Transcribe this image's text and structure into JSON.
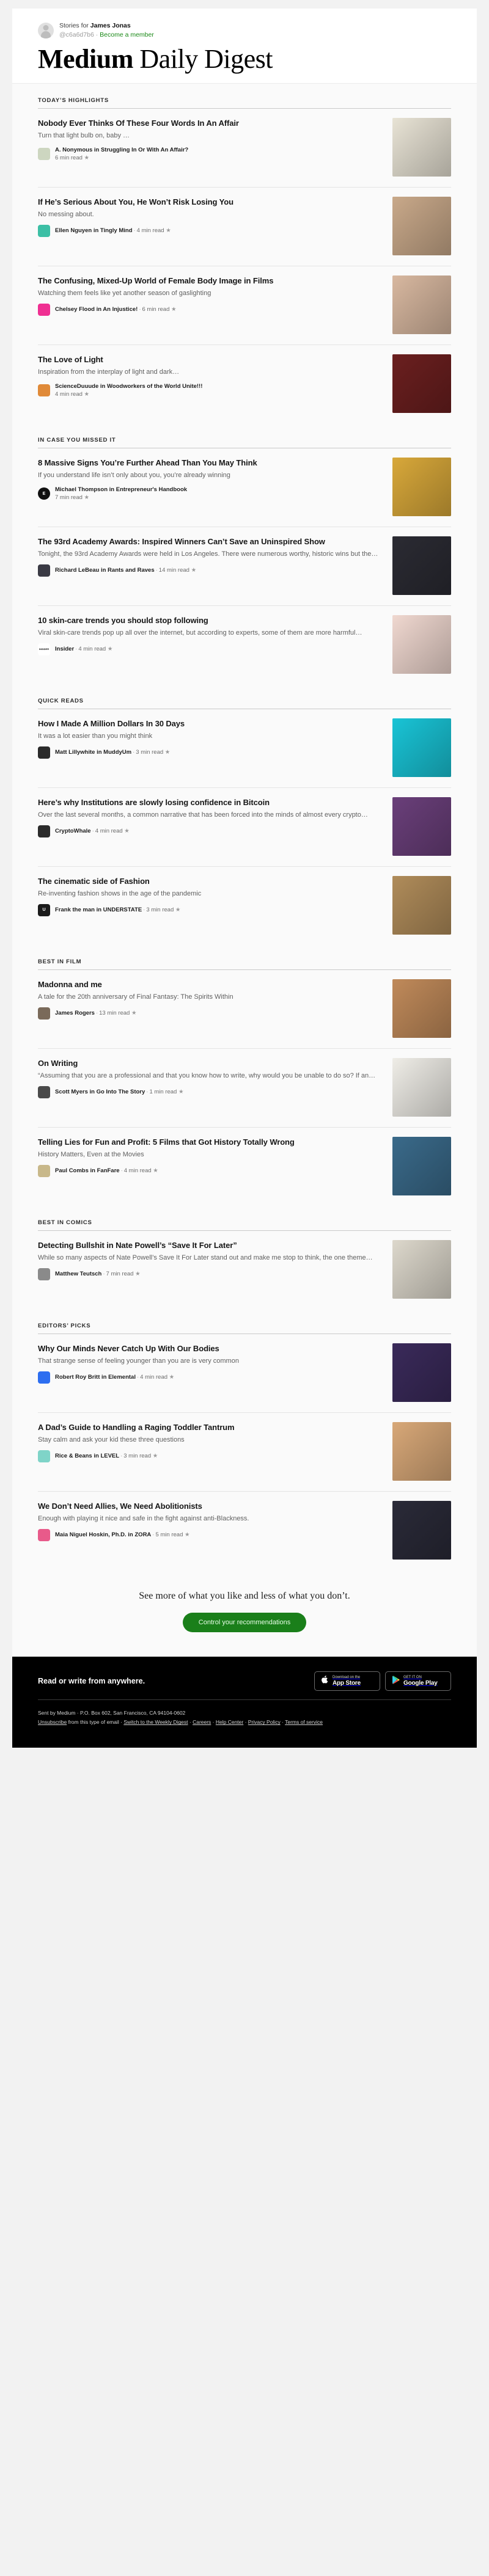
{
  "account": {
    "stories_for_prefix": "Stories for ",
    "user_name": "James Jonas",
    "handle": "@c6a6d7b6",
    "separator": " · ",
    "member_link": "Become a member"
  },
  "masthead": {
    "word_bold": "Medium",
    "word_light": " Daily Digest"
  },
  "sections": [
    {
      "title": "TODAY’S HIGHLIGHTS",
      "stories": [
        {
          "title": "Nobody Ever Thinks Of These Four Words In An Affair",
          "subtitle": "Turn that light bulb on, baby …",
          "author": "A. Nonymous in Struggling In Or With An Affair?",
          "read_time": "6 min read",
          "starred": "★",
          "byline_inline": false,
          "avatar_text": "",
          "avatar_color": "#cdd6c0",
          "thumb_color": "#e8e3d5"
        },
        {
          "title": "If He’s Serious About You, He Won’t Risk Losing You",
          "subtitle": "No messing about.",
          "author": "Ellen Nguyen in Tingly Mind",
          "read_time": "4 min read",
          "starred": "★",
          "byline_inline": true,
          "avatar_text": "",
          "avatar_color": "#3cbfa5",
          "thumb_color": "#c9a98a"
        },
        {
          "title": "The Confusing, Mixed-Up World of Female Body Image in Films",
          "subtitle": "Watching them feels like yet another season of gaslighting",
          "author": "Chelsey Flood in An Injustice!",
          "read_time": "6 min read",
          "starred": "★",
          "byline_inline": true,
          "avatar_text": "",
          "avatar_color": "#ef2f92",
          "thumb_color": "#d8b8a0"
        },
        {
          "title": "The Love of Light",
          "subtitle": "Inspiration from the interplay of light and dark…",
          "author": "ScienceDuuude in Woodworkers of the World Unite!!!",
          "read_time": "4 min read",
          "starred": "★",
          "byline_inline": false,
          "avatar_text": "",
          "avatar_color": "#e08a38",
          "thumb_color": "#6b1f1f"
        }
      ]
    },
    {
      "title": "IN CASE YOU MISSED IT",
      "stories": [
        {
          "title": "8 Massive Signs You’re Further Ahead Than You May Think",
          "subtitle": "If you understand life isn’t only about you, you’re already winning",
          "author": "Michael Thompson in Entrepreneur's Handbook",
          "read_time": "7 min read",
          "starred": "★",
          "byline_inline": false,
          "avatar_text": "E",
          "avatar_color": "#111111",
          "thumb_color": "#d8a83a"
        },
        {
          "title": "The 93rd Academy Awards: Inspired Winners Can’t Save an Uninspired Show",
          "subtitle": "Tonight, the 93rd Academy Awards were held in Los Angeles. There were numerous worthy, historic wins but the…",
          "author": "Richard LeBeau in Rants and Raves",
          "read_time": "14 min read",
          "starred": "★",
          "byline_inline": true,
          "avatar_text": "",
          "avatar_color": "#3a3a44",
          "thumb_color": "#2b2b33"
        },
        {
          "title": "10 skin-care trends you should stop following",
          "subtitle": "Viral skin-care trends pop up all over the internet, but according to experts, some of them are more harmful…",
          "author": "Insider",
          "read_time": "4 min read",
          "starred": "★",
          "byline_inline": true,
          "avatar_text": "INSIDER",
          "avatar_color": "#ffffff",
          "thumb_color": "#f0d8d0"
        }
      ]
    },
    {
      "title": "QUICK READS",
      "stories": [
        {
          "title": "How I Made A Million Dollars In 30 Days",
          "subtitle": "It was a lot easier than you might think",
          "author": "Matt Lillywhite in MuddyUm",
          "read_time": "3 min read",
          "starred": "★",
          "byline_inline": true,
          "avatar_text": "",
          "avatar_color": "#2a2a2a",
          "thumb_color": "#19c4d6"
        },
        {
          "title": "Here’s why Institutions are slowly losing confidence in Bitcoin",
          "subtitle": "Over the last several months, a common narrative that has been forced into the minds of almost every crypto…",
          "author": "CryptoWhale",
          "read_time": "4 min read",
          "starred": "★",
          "byline_inline": true,
          "avatar_text": "",
          "avatar_color": "#2b2b2b",
          "thumb_color": "#6a3f7a"
        },
        {
          "title": "The cinematic side of Fashion",
          "subtitle": "Re-inventing fashion shows in the age of the pandemic",
          "author": "Frank the man in UNDERSTATE",
          "read_time": "3 min read",
          "starred": "★",
          "byline_inline": true,
          "avatar_text": "U",
          "avatar_color": "#1b1b1b",
          "thumb_color": "#b08c5a"
        }
      ]
    },
    {
      "title": "BEST IN FILM",
      "stories": [
        {
          "title": "Madonna and me",
          "subtitle": "A tale for the 20th anniversary of Final Fantasy: The Spirits Within",
          "author": "James Rogers",
          "read_time": "13 min read",
          "starred": "★",
          "byline_inline": true,
          "avatar_text": "",
          "avatar_color": "#7a6a5a",
          "thumb_color": "#c08a5a"
        },
        {
          "title": "On Writing",
          "subtitle": "“Assuming that you are a professional and that you know how to write, why would you be unable to do so? If an…",
          "author": "Scott Myers in Go Into The Story",
          "read_time": "1 min read",
          "starred": "★",
          "byline_inline": true,
          "avatar_text": "",
          "avatar_color": "#4a4a4a",
          "thumb_color": "#efede7"
        },
        {
          "title": "Telling Lies for Fun and Profit: 5 Films that Got History Totally Wrong",
          "subtitle": "History Matters, Even at the Movies",
          "author": "Paul Combs in FanFare",
          "read_time": "4 min read",
          "starred": "★",
          "byline_inline": true,
          "avatar_text": "",
          "avatar_color": "#c8b88a",
          "thumb_color": "#3a6a8a"
        }
      ]
    },
    {
      "title": "BEST IN COMICS",
      "stories": [
        {
          "title": "Detecting Bullshit in Nate Powell’s “Save It For Later”",
          "subtitle": "While so many aspects of Nate Powell’s Save It For Later stand out and make me stop to think, the one theme…",
          "author": "Matthew Teutsch",
          "read_time": "7 min read",
          "starred": "★",
          "byline_inline": true,
          "avatar_text": "",
          "avatar_color": "#8a8a8a",
          "thumb_color": "#ddd8cc"
        }
      ]
    },
    {
      "title": "EDITORS’ PICKS",
      "stories": [
        {
          "title": "Why Our Minds Never Catch Up With Our Bodies",
          "subtitle": "That strange sense of feeling younger than you are is very common",
          "author": "Robert Roy Britt in Elemental",
          "read_time": "4 min read",
          "starred": "★",
          "byline_inline": true,
          "avatar_text": "",
          "avatar_color": "#2d6ef0",
          "thumb_color": "#3a2a5a"
        },
        {
          "title": "A Dad’s Guide to Handling a Raging Toddler Tantrum",
          "subtitle": "Stay calm and ask your kid these three questions",
          "author": "Rice & Beans in LEVEL",
          "read_time": "3 min read",
          "starred": "★",
          "byline_inline": true,
          "avatar_text": "",
          "avatar_color": "#7fd4c8",
          "thumb_color": "#d8a878"
        },
        {
          "title": "We Don’t Need Allies, We Need Abolitionists",
          "subtitle": "Enough with playing it nice and safe in the fight against anti-Blackness.",
          "author": "Maia Niguel Hoskin, Ph.D. in ZORA",
          "read_time": "5 min read",
          "starred": "★",
          "byline_inline": true,
          "avatar_text": "",
          "avatar_color": "#e85a8a",
          "thumb_color": "#2a2a38"
        }
      ]
    }
  ],
  "cta": {
    "text": "See more of what you like and less of what you don’t.",
    "button_label": "Control your recommendations"
  },
  "footer": {
    "heading": "Read or write from anywhere.",
    "badges": [
      {
        "icon": "apple-icon",
        "line1": "Download on the",
        "line2": "App Store"
      },
      {
        "icon": "google-play-icon",
        "line1": "GET IT ON",
        "line2": "Google Play"
      }
    ],
    "legal_line1": "Sent by Medium · P.O. Box 602, San Francisco, CA 94104-0602",
    "legal_unsubscribe": "Unsubscribe",
    "legal_line2_mid": " from this type of email · ",
    "legal_switch": "Switch to the Weekly Digest",
    "legal_sep1": " · ",
    "legal_careers": "Careers",
    "legal_sep2": " · ",
    "legal_help": "Help Center",
    "legal_sep3": " · ",
    "legal_privacy": "Privacy Policy",
    "legal_sep4": " · ",
    "legal_terms": "Terms of service"
  }
}
